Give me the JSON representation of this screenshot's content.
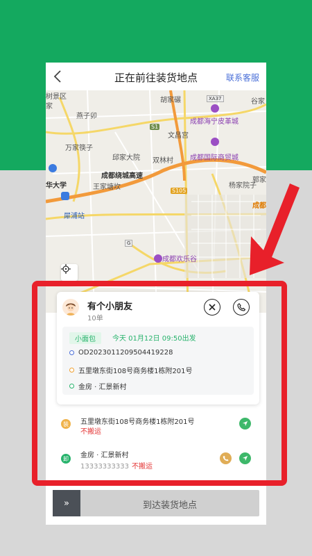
{
  "header": {
    "title": "正在前往装货地点",
    "service_label": "联系客服"
  },
  "map": {
    "labels": {
      "shujingqu": "树景区",
      "jia": "家",
      "yanzisi": "燕子卯",
      "huzhuang": "胡家碾",
      "xa37": "XA37",
      "guxing": "谷家",
      "s1": "S1",
      "wenshengong": "文昌宫",
      "haining": "成都海宁皮革城",
      "wanjia": "万家筷子",
      "qiujia": "邱家大院",
      "shuanglin": "双林村",
      "guoji": "成都国际商贸城",
      "raocheng": "成都绕城高速",
      "huadaxue": "华大学",
      "wangjiatang": "王家塘坎",
      "s105": "S105",
      "yangjia": "杨家院子",
      "guojia": "郭家",
      "xipu": "犀浦站",
      "chengdu": "成都",
      "huanlegu": "成都欢乐谷",
      "g": "G"
    }
  },
  "driver": {
    "name": "有个小朋友",
    "orders": "10单",
    "vehicle": "小面包",
    "depart_time": "今天 01月12日 09:50出发",
    "order_no": "OD2023011209504419228",
    "load_addr": "五里墩东街108号商务楼1栋附201号",
    "unload_addr": "金房 · 汇景新村"
  },
  "stops": [
    {
      "badge": "装",
      "address": "五里墩东街108号商务楼1栋附201号",
      "note": "不搬运",
      "phone": ""
    },
    {
      "badge": "卸",
      "address": "金房 · 汇景新村",
      "note": "不搬运",
      "phone": "13333333333"
    }
  ],
  "arrive": {
    "handle": "»",
    "label": "到达装货地点"
  },
  "colors": {
    "brand_green": "#14a95f",
    "accent_green": "#27b36c",
    "highlight_red": "#e8202a",
    "link_blue": "#4a6fd8",
    "warning_red": "#e43535"
  }
}
